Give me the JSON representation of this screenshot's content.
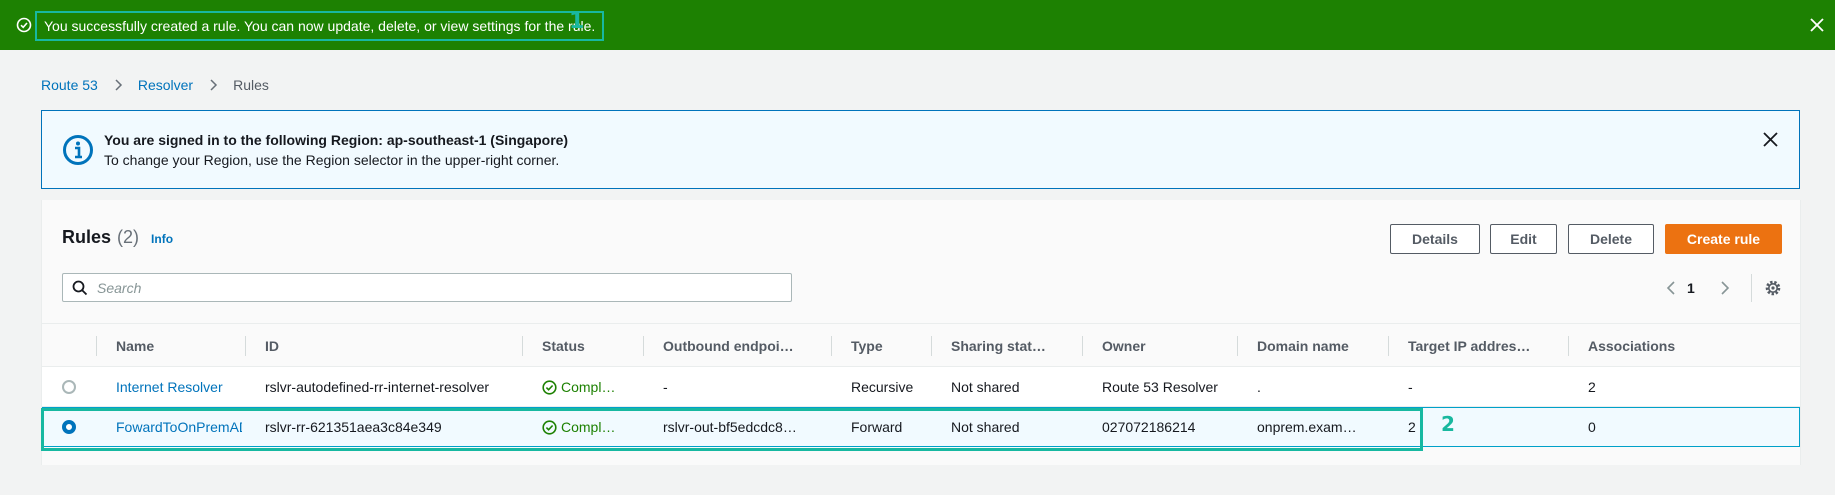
{
  "flash": {
    "message": "You successfully created a rule. You can now update, delete, or view settings for the rule.",
    "annotation": "1"
  },
  "breadcrumb": {
    "items": [
      "Route 53",
      "Resolver",
      "Rules"
    ]
  },
  "region_alert": {
    "title": "You are signed in to the following Region: ap-southeast-1 (Singapore)",
    "description": "To change your Region, use the Region selector in the upper-right corner."
  },
  "rules": {
    "title": "Rules",
    "count": "(2)",
    "info_label": "Info",
    "buttons": {
      "details": "Details",
      "edit": "Edit",
      "delete": "Delete",
      "create": "Create rule"
    },
    "search_placeholder": "Search",
    "page": "1",
    "columns": [
      "Name",
      "ID",
      "Status",
      "Outbound endpoi…",
      "Type",
      "Sharing stat…",
      "Owner",
      "Domain name",
      "Target IP addres…",
      "Associations"
    ],
    "rows": [
      {
        "selected": false,
        "name": "Internet Resolver",
        "id": "rslvr-autodefined-rr-internet-resolver",
        "status": "Compl…",
        "outbound": "-",
        "type": "Recursive",
        "sharing": "Not shared",
        "owner": "Route 53 Resolver",
        "domain": ".",
        "target_ip": "-",
        "associations": "2"
      },
      {
        "selected": true,
        "name": "FowardToOnPremAD",
        "id": "rslvr-rr-621351aea3c84e349",
        "status": "Compl…",
        "outbound": "rslvr-out-bf5edcdc8…",
        "type": "Forward",
        "sharing": "Not shared",
        "owner": "027072186214",
        "domain": "onprem.exam…",
        "target_ip": "2",
        "associations": "0"
      }
    ],
    "row_annotation": "2"
  },
  "colors": {
    "success": "#1d8102",
    "link": "#0073bb",
    "primary_button": "#ec7211",
    "annotation": "#17b8a1",
    "info_background": "#f1faff"
  }
}
